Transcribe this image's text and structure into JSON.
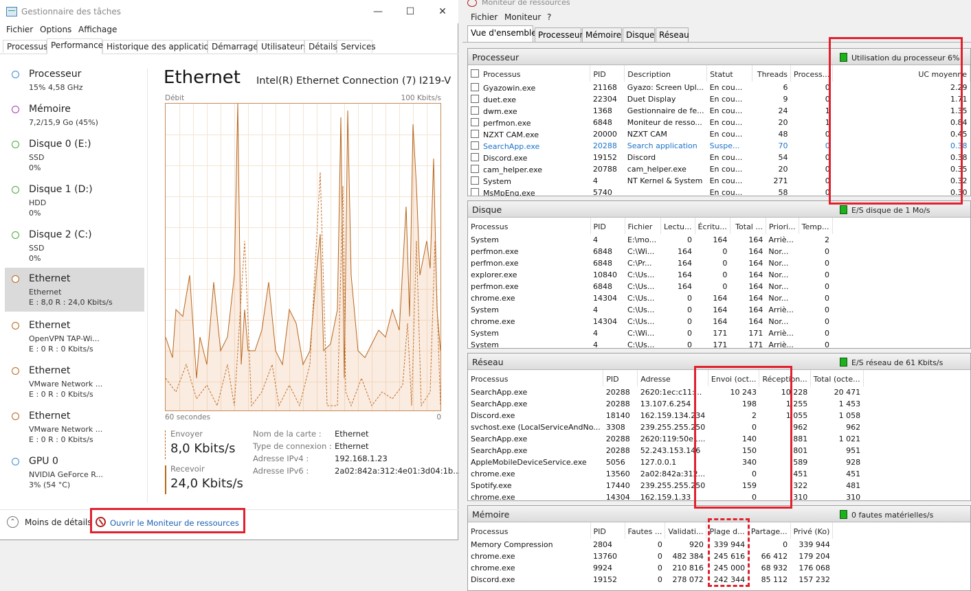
{
  "task_manager": {
    "title": "Gestionnaire des tâches",
    "menu": [
      "Fichier",
      "Options",
      "Affichage"
    ],
    "tabs": [
      "Processus",
      "Performance",
      "Historique des applications",
      "Démarrage",
      "Utilisateurs",
      "Détails",
      "Services"
    ],
    "active_tab": "Performance",
    "sidebar": [
      {
        "name": "Processeur",
        "sub1": "15% 4,58 GHz",
        "sub2": "",
        "color": "#3b8ad4"
      },
      {
        "name": "Mémoire",
        "sub1": "7,2/15,9 Go (45%)",
        "sub2": "",
        "color": "#a43ab0"
      },
      {
        "name": "Disque 0 (E:)",
        "sub1": "SSD",
        "sub2": "0%",
        "color": "#4aa83c"
      },
      {
        "name": "Disque 1 (D:)",
        "sub1": "HDD",
        "sub2": "0%",
        "color": "#4aa83c"
      },
      {
        "name": "Disque 2 (C:)",
        "sub1": "SSD",
        "sub2": "0%",
        "color": "#4aa83c"
      },
      {
        "name": "Ethernet",
        "sub1": "Ethernet",
        "sub2": "E : 8,0 R : 24,0 Kbits/s",
        "color": "#b8651a",
        "selected": true
      },
      {
        "name": "Ethernet",
        "sub1": "OpenVPN TAP-Wi...",
        "sub2": "E : 0 R : 0 Kbits/s",
        "color": "#b8651a"
      },
      {
        "name": "Ethernet",
        "sub1": "VMware Network ...",
        "sub2": "E : 0 R : 0 Kbits/s",
        "color": "#b8651a"
      },
      {
        "name": "Ethernet",
        "sub1": "VMware Network ...",
        "sub2": "E : 0 R : 0 Kbits/s",
        "color": "#b8651a"
      },
      {
        "name": "GPU 0",
        "sub1": "NVIDIA GeForce R...",
        "sub2": "3% (54 °C)",
        "color": "#3b8ad4"
      }
    ],
    "main": {
      "heading": "Ethernet",
      "adapter": "Intel(R) Ethernet Connection (7) I219-V",
      "graph_label": "Débit",
      "graph_max": "100 Kbits/s",
      "graph_xlabel": "60 secondes",
      "graph_xmin": "0",
      "send_label": "Envoyer",
      "send_value": "8,0 Kbits/s",
      "recv_label": "Recevoir",
      "recv_value": "24,0 Kbits/s",
      "info": [
        {
          "label": "Nom de la carte :",
          "value": "Ethernet"
        },
        {
          "label": "Type de connexion :",
          "value": "Ethernet"
        },
        {
          "label": "Adresse IPv4 :",
          "value": "192.168.1.23"
        },
        {
          "label": "Adresse IPv6 :",
          "value": "2a02:842a:312:4e01:3d04:1b..."
        }
      ],
      "graph_color": "#b8651a"
    },
    "footer": {
      "less_details": "Moins de détails",
      "open_monitor": "Ouvrir le Moniteur de ressources"
    }
  },
  "resource_monitor": {
    "title": "Moniteur de ressources",
    "menu": [
      "Fichier",
      "Moniteur",
      "?"
    ],
    "tabs": [
      "Vue d'ensemble",
      "Processeur",
      "Mémoire",
      "Disque",
      "Réseau"
    ],
    "cpu": {
      "title": "Processeur",
      "stat": "Utilisation du processeur 6%",
      "columns": [
        "Processus",
        "PID",
        "Description",
        "Statut",
        "Threads",
        "Process...",
        "UC moyenne"
      ],
      "rows": [
        [
          "Gyazowin.exe",
          "21168",
          "Gyazo: Screen Upl...",
          "En cou...",
          "6",
          "0",
          "2.29"
        ],
        [
          "duet.exe",
          "22304",
          "Duet Display",
          "En cou...",
          "9",
          "0",
          "1.71"
        ],
        [
          "dwm.exe",
          "1368",
          "Gestionnaire de fe...",
          "En cou...",
          "24",
          "1",
          "1.35"
        ],
        [
          "perfmon.exe",
          "6848",
          "Moniteur de resso...",
          "En cou...",
          "20",
          "1",
          "0.84"
        ],
        [
          "NZXT CAM.exe",
          "20000",
          "NZXT CAM",
          "En cou...",
          "48",
          "0",
          "0.45"
        ],
        [
          "SearchApp.exe",
          "20288",
          "Search application",
          "Suspe...",
          "70",
          "0",
          "0.38"
        ],
        [
          "Discord.exe",
          "19152",
          "Discord",
          "En cou...",
          "54",
          "0",
          "0.38"
        ],
        [
          "cam_helper.exe",
          "20788",
          "cam_helper.exe",
          "En cou...",
          "20",
          "0",
          "0.35"
        ],
        [
          "System",
          "4",
          "NT Kernel & System",
          "En cou...",
          "271",
          "0",
          "0.32"
        ],
        [
          "MsMpEng.exe",
          "5740",
          "",
          "En cou...",
          "58",
          "0",
          "0.30"
        ]
      ],
      "highlight_row": 5
    },
    "disk": {
      "title": "Disque",
      "stat": "E/S disque de 1 Mo/s",
      "columns": [
        "Processus",
        "PID",
        "Fichier",
        "Lectu...",
        "Écritu...",
        "Total ...",
        "Priori...",
        "Temp..."
      ],
      "rows": [
        [
          "System",
          "4",
          "E:\\mo...",
          "0",
          "164",
          "164",
          "Arriè...",
          "2"
        ],
        [
          "perfmon.exe",
          "6848",
          "C:\\Wi...",
          "164",
          "0",
          "164",
          "Nor...",
          "0"
        ],
        [
          "perfmon.exe",
          "6848",
          "C:\\Pr...",
          "164",
          "0",
          "164",
          "Nor...",
          "0"
        ],
        [
          "explorer.exe",
          "10840",
          "C:\\Us...",
          "164",
          "0",
          "164",
          "Nor...",
          "0"
        ],
        [
          "perfmon.exe",
          "6848",
          "C:\\Us...",
          "164",
          "0",
          "164",
          "Nor...",
          "0"
        ],
        [
          "chrome.exe",
          "14304",
          "C:\\Us...",
          "0",
          "164",
          "164",
          "Nor...",
          "0"
        ],
        [
          "System",
          "4",
          "C:\\Us...",
          "0",
          "164",
          "164",
          "Arriè...",
          "0"
        ],
        [
          "chrome.exe",
          "14304",
          "C:\\Us...",
          "0",
          "164",
          "164",
          "Nor...",
          "0"
        ],
        [
          "System",
          "4",
          "C:\\Wi...",
          "0",
          "171",
          "171",
          "Arriè...",
          "0"
        ],
        [
          "System",
          "4",
          "C:\\Us...",
          "0",
          "171",
          "171",
          "Arriè...",
          "0"
        ]
      ]
    },
    "network": {
      "title": "Réseau",
      "stat": "E/S réseau de 61 Kbits/s",
      "columns": [
        "Processus",
        "PID",
        "Adresse",
        "Envoi (oct...",
        "Réception...",
        "Total (octe..."
      ],
      "rows": [
        [
          "SearchApp.exe",
          "20288",
          "2620:1ec:c11:...",
          "10 243",
          "10 228",
          "20 471"
        ],
        [
          "SearchApp.exe",
          "20288",
          "13.107.6.254",
          "198",
          "1 255",
          "1 453"
        ],
        [
          "Discord.exe",
          "18140",
          "162.159.134.234",
          "2",
          "1 055",
          "1 058"
        ],
        [
          "svchost.exe (LocalServiceAndNo...",
          "3308",
          "239.255.255.250",
          "0",
          "962",
          "962"
        ],
        [
          "SearchApp.exe",
          "20288",
          "2620:119:50e1...",
          "140",
          "881",
          "1 021"
        ],
        [
          "SearchApp.exe",
          "20288",
          "52.243.153.146",
          "150",
          "801",
          "951"
        ],
        [
          "AppleMobileDeviceService.exe",
          "5056",
          "127.0.0.1",
          "340",
          "589",
          "928"
        ],
        [
          "chrome.exe",
          "13560",
          "2a02:842a:312...",
          "0",
          "451",
          "451"
        ],
        [
          "Spotify.exe",
          "17440",
          "239.255.255.250",
          "159",
          "322",
          "481"
        ],
        [
          "chrome.exe",
          "14304",
          "162.159.1.33",
          "0",
          "310",
          "310"
        ]
      ]
    },
    "memory": {
      "title": "Mémoire",
      "stat": "0 fautes matérielles/s",
      "columns": [
        "Processus",
        "PID",
        "Fautes ...",
        "Validati...",
        "Plage d...",
        "Partage...",
        "Privé (Ko)"
      ],
      "rows": [
        [
          "Memory Compression",
          "2804",
          "0",
          "920",
          "339 944",
          "0",
          "339 944"
        ],
        [
          "chrome.exe",
          "13760",
          "0",
          "482 384",
          "245 616",
          "66 412",
          "179 204"
        ],
        [
          "chrome.exe",
          "9924",
          "0",
          "210 816",
          "245 000",
          "68 932",
          "176 068"
        ],
        [
          "Discord.exe",
          "19152",
          "0",
          "278 072",
          "242 344",
          "85 112",
          "157 232"
        ]
      ]
    }
  }
}
